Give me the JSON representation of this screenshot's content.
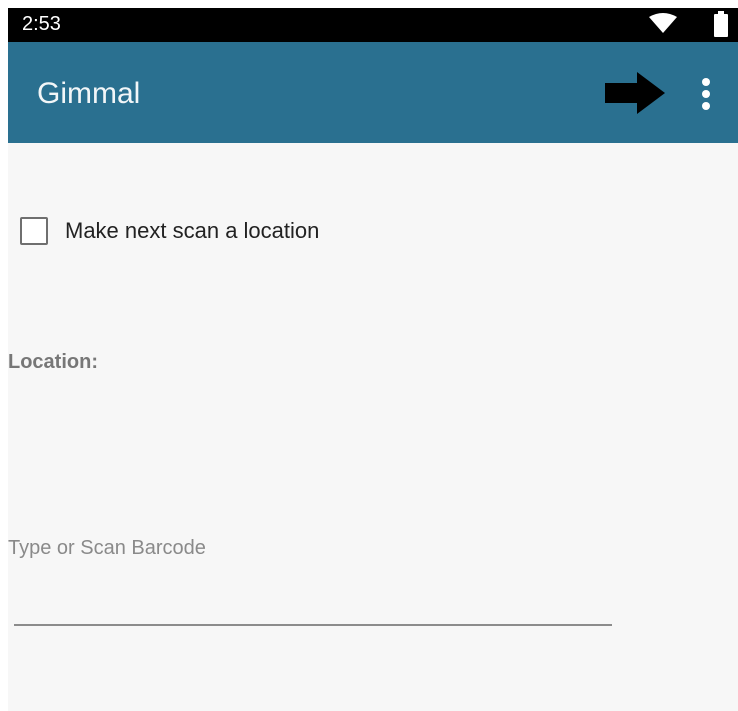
{
  "status_bar": {
    "time": "2:53",
    "wifi_icon": "wifi-icon",
    "battery_icon": "battery-icon"
  },
  "app_bar": {
    "title": "Gimmal",
    "background_color": "#2a7090",
    "forward_icon": "arrow-right-icon",
    "menu_icon": "more-vert-icon"
  },
  "form": {
    "checkbox": {
      "label": "Make next scan a location",
      "checked": false
    },
    "location_label": "Location:",
    "barcode": {
      "placeholder": "Type or Scan Barcode",
      "value": ""
    }
  }
}
